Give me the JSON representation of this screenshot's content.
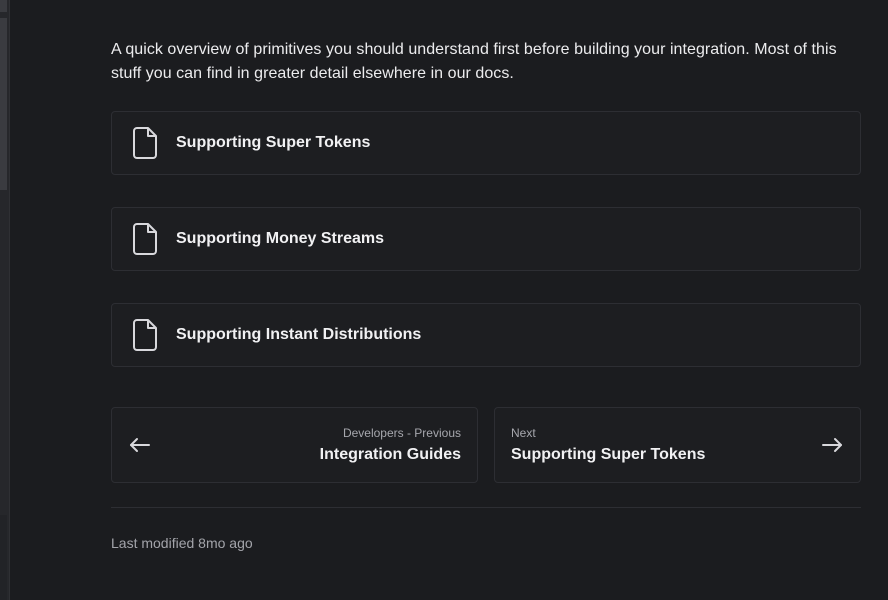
{
  "intro": {
    "text": "A quick overview of primitives you should understand first before building your integration. Most of this stuff you can find in greater detail elsewhere in our docs."
  },
  "cards": [
    {
      "label": "Supporting Super Tokens",
      "icon": "document-icon"
    },
    {
      "label": "Supporting Money Streams",
      "icon": "document-icon"
    },
    {
      "label": "Supporting Instant Distributions",
      "icon": "document-icon"
    }
  ],
  "pager": {
    "prev": {
      "small": "Developers - Previous",
      "title": "Integration Guides",
      "icon": "arrow-left-icon"
    },
    "next": {
      "small": "Next",
      "title": "Supporting Super Tokens",
      "icon": "arrow-right-icon"
    }
  },
  "footer": {
    "last_modified": "Last modified 8mo ago"
  },
  "colors": {
    "background": "#1b1c1f",
    "card_border": "#2d2e33",
    "text": "#ececee",
    "muted_text": "#a3a4aa"
  }
}
